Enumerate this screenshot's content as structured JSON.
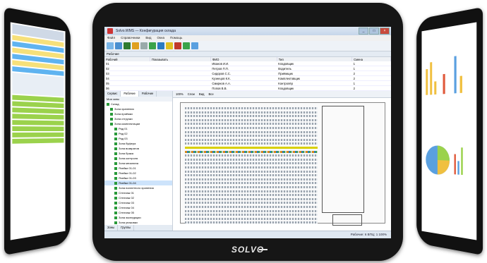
{
  "app": {
    "title": "Solvo.WMS — Конфигурация склада",
    "window_buttons": [
      "_",
      "□",
      "×"
    ]
  },
  "menu": [
    "Файл",
    "Справочники",
    "Вид",
    "Окна",
    "Помощь"
  ],
  "top_panel": {
    "title": "Рабочие",
    "columns": [
      "Рабочий",
      "Показывать",
      "ФИО",
      "Тип",
      "Смена"
    ],
    "rows": [
      [
        "01",
        "",
        "Иванов И.И.",
        "Кладовщик",
        "1"
      ],
      [
        "02",
        "",
        "Петров П.П.",
        "Водитель",
        "1"
      ],
      [
        "03",
        "",
        "Сидоров С.С.",
        "Приёмщик",
        "2"
      ],
      [
        "04",
        "",
        "Кузнецов К.К.",
        "Комплектовщик",
        "2"
      ],
      [
        "05",
        "",
        "Смирнов А.А.",
        "Контролёр",
        "1"
      ],
      [
        "06",
        "",
        "Попов В.В.",
        "Кладовщик",
        "2"
      ]
    ]
  },
  "left_pane": {
    "tabs": [
      "Сервис",
      "Рабочие",
      "Рабочие"
    ],
    "header": "Мои зоны",
    "tree": [
      "Склад",
      "Зона хранения",
      "Зона приёмки",
      "Зона отгрузки",
      "Зона комплектации",
      "Ряд 01",
      "Ряд 02",
      "Ряд 03",
      "Зона буфера",
      "Зона возвратов",
      "Зона брака",
      "Зона контроля",
      "Зона мезонина",
      "Ячейки 01-01",
      "Ячейки 01-02",
      "Ячейки 01-03",
      "Ячейки 01-04",
      "Зона паллетного хранения",
      "Стеллаж 01",
      "Стеллаж 02",
      "Стеллаж 03",
      "Стеллаж 04",
      "Стеллаж 05",
      "Зона экспедиции",
      "Зона упаковки"
    ],
    "selected_index": 16,
    "bottom_tabs": [
      "Зоны",
      "Группы"
    ]
  },
  "map_toolbar": [
    "100%",
    "Слои",
    "Вид",
    "Все"
  ],
  "statusbar": "Рабочие: 6   ВПЦ: 1   100%",
  "logo": "SOLVO",
  "colors": {
    "accent": "#2a9a3a",
    "rack_orange": "#d98a1a",
    "rack_blue": "#2a7bc2",
    "selection": "#cde3fb"
  }
}
